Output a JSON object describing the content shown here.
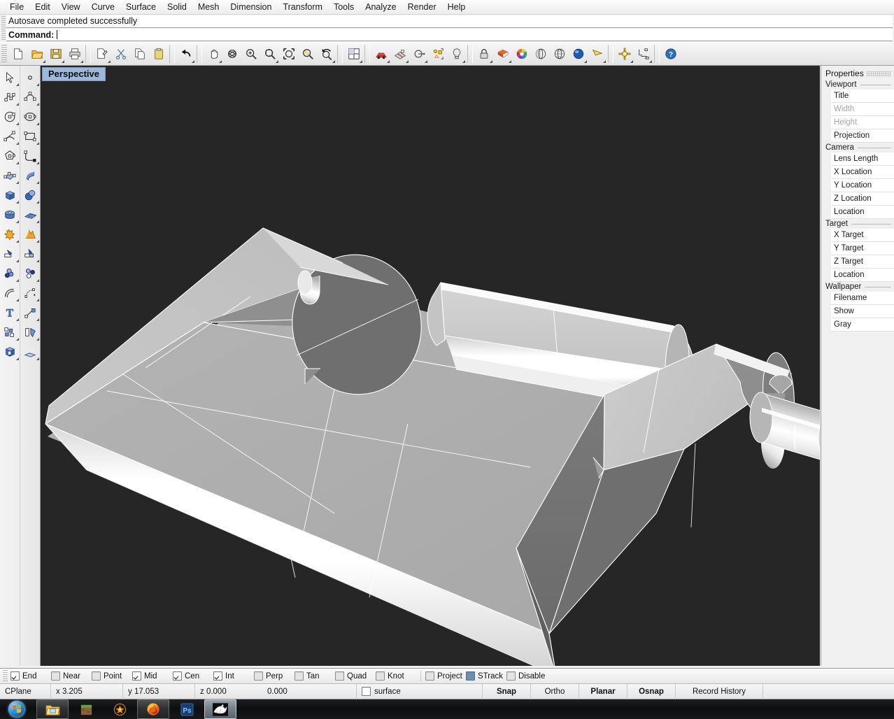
{
  "app": {
    "name": "Rhinoceros"
  },
  "menu": {
    "items": [
      {
        "label": "File"
      },
      {
        "label": "Edit"
      },
      {
        "label": "View"
      },
      {
        "label": "Curve"
      },
      {
        "label": "Surface"
      },
      {
        "label": "Solid"
      },
      {
        "label": "Mesh"
      },
      {
        "label": "Dimension"
      },
      {
        "label": "Transform"
      },
      {
        "label": "Tools"
      },
      {
        "label": "Analyze"
      },
      {
        "label": "Render"
      },
      {
        "label": "Help"
      }
    ]
  },
  "command": {
    "history": "Autosave completed successfully",
    "prompt_label": "Command:",
    "input_value": "",
    "placeholder": ""
  },
  "toolbar": {
    "buttons": [
      {
        "name": "new-icon",
        "title": "New"
      },
      {
        "name": "open-icon",
        "title": "Open"
      },
      {
        "name": "save-icon",
        "title": "Save"
      },
      {
        "name": "print-icon",
        "title": "Print"
      },
      {
        "name": "copy-to-clipboard-icon",
        "title": "Copy to clipboard"
      },
      {
        "name": "cut-icon",
        "title": "Cut"
      },
      {
        "name": "copy-icon",
        "title": "Copy"
      },
      {
        "name": "paste-icon",
        "title": "Paste"
      },
      {
        "name": "undo-icon",
        "title": "Undo"
      },
      {
        "name": "pan-icon",
        "title": "Pan"
      },
      {
        "name": "rotate-view-icon",
        "title": "Rotate view"
      },
      {
        "name": "zoom-in-icon",
        "title": "Zoom in"
      },
      {
        "name": "zoom-window-icon",
        "title": "Zoom window"
      },
      {
        "name": "zoom-extents-icon",
        "title": "Zoom extents"
      },
      {
        "name": "zoom-selected-icon",
        "title": "Zoom selected"
      },
      {
        "name": "zoom-previous-icon",
        "title": "Zoom previous"
      },
      {
        "name": "four-viewports-icon",
        "title": "4 viewports"
      },
      {
        "name": "car-render-icon",
        "title": "Render"
      },
      {
        "name": "layout-icon",
        "title": "Layout"
      },
      {
        "name": "cplane-icon",
        "title": "Set CPlane"
      },
      {
        "name": "named-position-icon",
        "title": "Named position"
      },
      {
        "name": "light-bulb-icon",
        "title": "Lights"
      },
      {
        "name": "lock-icon",
        "title": "Lock"
      },
      {
        "name": "material-icon",
        "title": "Material"
      },
      {
        "name": "color-wheel-icon",
        "title": "Color"
      },
      {
        "name": "shaded-view-icon",
        "title": "Shaded"
      },
      {
        "name": "ghosted-view-icon",
        "title": "Ghosted"
      },
      {
        "name": "rendered-view-icon",
        "title": "Rendered"
      },
      {
        "name": "flamingo-icon",
        "title": "Flamingo render"
      },
      {
        "name": "options-gear-icon",
        "title": "Options"
      },
      {
        "name": "dimension-icon",
        "title": "Dimension"
      },
      {
        "name": "help-icon",
        "title": "Help"
      }
    ]
  },
  "sidebar": {
    "left_column": [
      {
        "name": "select-arrow-icon",
        "label": "Select"
      },
      {
        "name": "polyline-icon",
        "label": "Polyline"
      },
      {
        "name": "circle-icon",
        "label": "Circle"
      },
      {
        "name": "arc-icon",
        "label": "Arc"
      },
      {
        "name": "polygon-icon",
        "label": "Polygon"
      },
      {
        "name": "surface-from-points-icon",
        "label": "Surface from points"
      },
      {
        "name": "box-icon",
        "label": "Box"
      },
      {
        "name": "cylinder-icon",
        "label": "Cylinder"
      },
      {
        "name": "boolean-union-icon",
        "label": "Boolean union"
      },
      {
        "name": "trim-icon",
        "label": "Trim"
      },
      {
        "name": "fillet-icon",
        "label": "Fillet"
      },
      {
        "name": "offset-curve-icon",
        "label": "Offset"
      },
      {
        "name": "text-icon",
        "label": "Text"
      },
      {
        "name": "array-icon",
        "label": "Array"
      },
      {
        "name": "cap-solid-icon",
        "label": "Cap"
      }
    ],
    "right_column": [
      {
        "name": "point-icon",
        "label": "Point"
      },
      {
        "name": "curve-icon",
        "label": "Control point curve"
      },
      {
        "name": "ellipse-icon",
        "label": "Ellipse"
      },
      {
        "name": "rectangle-icon",
        "label": "Rectangle"
      },
      {
        "name": "curve-tools-icon",
        "label": "Curve tools"
      },
      {
        "name": "extrude-surface-icon",
        "label": "Extrude surface"
      },
      {
        "name": "sphere-icon",
        "label": "Sphere"
      },
      {
        "name": "mesh-icon",
        "label": "Mesh"
      },
      {
        "name": "boolean-difference-icon",
        "label": "Boolean difference"
      },
      {
        "name": "split-icon",
        "label": "Split"
      },
      {
        "name": "blend-icon",
        "label": "Blend"
      },
      {
        "name": "variable-fillet-icon",
        "label": "Variable fillet"
      },
      {
        "name": "scale-icon",
        "label": "Scale"
      },
      {
        "name": "mirror-icon",
        "label": "Mirror"
      },
      {
        "name": "extrude-icon",
        "label": "Extrude"
      }
    ]
  },
  "viewport": {
    "tab_label": "Perspective",
    "background": "#262626",
    "wire_color": "#ffffff",
    "display_mode": "Shaded"
  },
  "properties": {
    "title": "Properties",
    "groups": [
      {
        "name": "Viewport",
        "rows": [
          {
            "label": "Title",
            "dim": false
          },
          {
            "label": "Width",
            "dim": true
          },
          {
            "label": "Height",
            "dim": true
          },
          {
            "label": "Projection",
            "dim": false
          }
        ]
      },
      {
        "name": "Camera",
        "rows": [
          {
            "label": "Lens Length",
            "dim": false
          },
          {
            "label": "X Location",
            "dim": false
          },
          {
            "label": "Y Location",
            "dim": false
          },
          {
            "label": "Z Location",
            "dim": false
          },
          {
            "label": "Location",
            "dim": false
          }
        ]
      },
      {
        "name": "Target",
        "rows": [
          {
            "label": "X Target",
            "dim": false
          },
          {
            "label": "Y Target",
            "dim": false
          },
          {
            "label": "Z Target",
            "dim": false
          },
          {
            "label": "Location",
            "dim": false
          }
        ]
      },
      {
        "name": "Wallpaper",
        "rows": [
          {
            "label": "Filename",
            "dim": false
          },
          {
            "label": "Show",
            "dim": false
          },
          {
            "label": "Gray",
            "dim": false
          }
        ]
      }
    ]
  },
  "osnap": {
    "items": [
      {
        "label": "End",
        "state": "checked"
      },
      {
        "label": "Near",
        "state": "flat"
      },
      {
        "label": "Point",
        "state": "flat"
      },
      {
        "label": "Mid",
        "state": "checked"
      },
      {
        "label": "Cen",
        "state": "checked"
      },
      {
        "label": "Int",
        "state": "checked"
      },
      {
        "label": "Perp",
        "state": "flat"
      },
      {
        "label": "Tan",
        "state": "flat"
      },
      {
        "label": "Quad",
        "state": "flat"
      },
      {
        "label": "Knot",
        "state": "flat"
      },
      {
        "label": "Project",
        "state": "flat"
      },
      {
        "label": "STrack",
        "state": "filled"
      },
      {
        "label": "Disable",
        "state": "flat"
      }
    ]
  },
  "status": {
    "cplane": "CPlane",
    "x": "x 3.205",
    "y": "y 17.053",
    "z": "z 0.000",
    "extra": "0.000",
    "layer": "surface",
    "toggles": [
      {
        "label": "Snap",
        "bold": true
      },
      {
        "label": "Ortho",
        "bold": false
      },
      {
        "label": "Planar",
        "bold": true
      },
      {
        "label": "Osnap",
        "bold": true
      },
      {
        "label": "Record History",
        "bold": false
      }
    ]
  },
  "taskbar": {
    "start_label": "Start",
    "apps": [
      {
        "name": "explorer-icon",
        "label": "Windows Explorer",
        "state": "run"
      },
      {
        "name": "minecraft-icon",
        "label": "Minecraft",
        "state": "pinnedonly"
      },
      {
        "name": "diablo-icon",
        "label": "Diablo III",
        "state": "pinnedonly"
      },
      {
        "name": "firefox-icon",
        "label": "Mozilla Firefox",
        "state": "run"
      },
      {
        "name": "photoshop-icon",
        "label": "Adobe Photoshop",
        "state": "pinnedonly"
      },
      {
        "name": "rhino-icon",
        "label": "Rhinoceros",
        "state": "active"
      }
    ]
  },
  "colors": {
    "viewport_bg": "#262626",
    "chrome": "#f0f0f0",
    "tab_accent": "#9db9da",
    "taskbar": "#0c0e10"
  }
}
